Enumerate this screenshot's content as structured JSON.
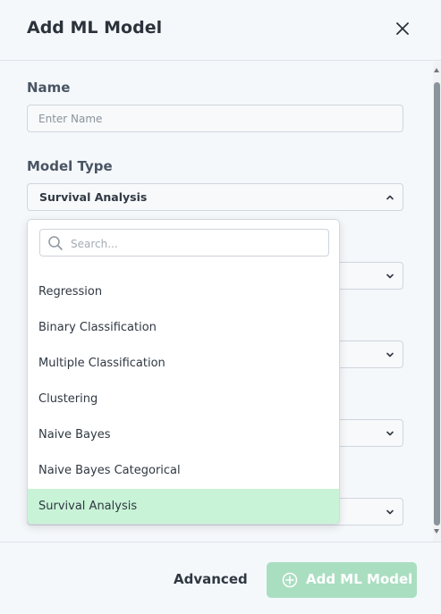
{
  "dialog": {
    "title": "Add ML Model"
  },
  "form": {
    "name_label": "Name",
    "name_value": "",
    "name_placeholder": "Enter Name",
    "model_type_label": "Model Type",
    "model_type_value": "Survival Analysis"
  },
  "dropdown": {
    "search_placeholder": "Search...",
    "search_value": "",
    "options": [
      "Regression",
      "Binary Classification",
      "Multiple Classification",
      "Clustering",
      "Naive Bayes",
      "Naive Bayes Categorical",
      "Survival Analysis"
    ],
    "selected": "Survival Analysis"
  },
  "footer": {
    "advanced_label": "Advanced",
    "add_label": "Add ML Model"
  },
  "colors": {
    "selected_option": "#c8f3d7",
    "primary_button": "#aadec1"
  }
}
